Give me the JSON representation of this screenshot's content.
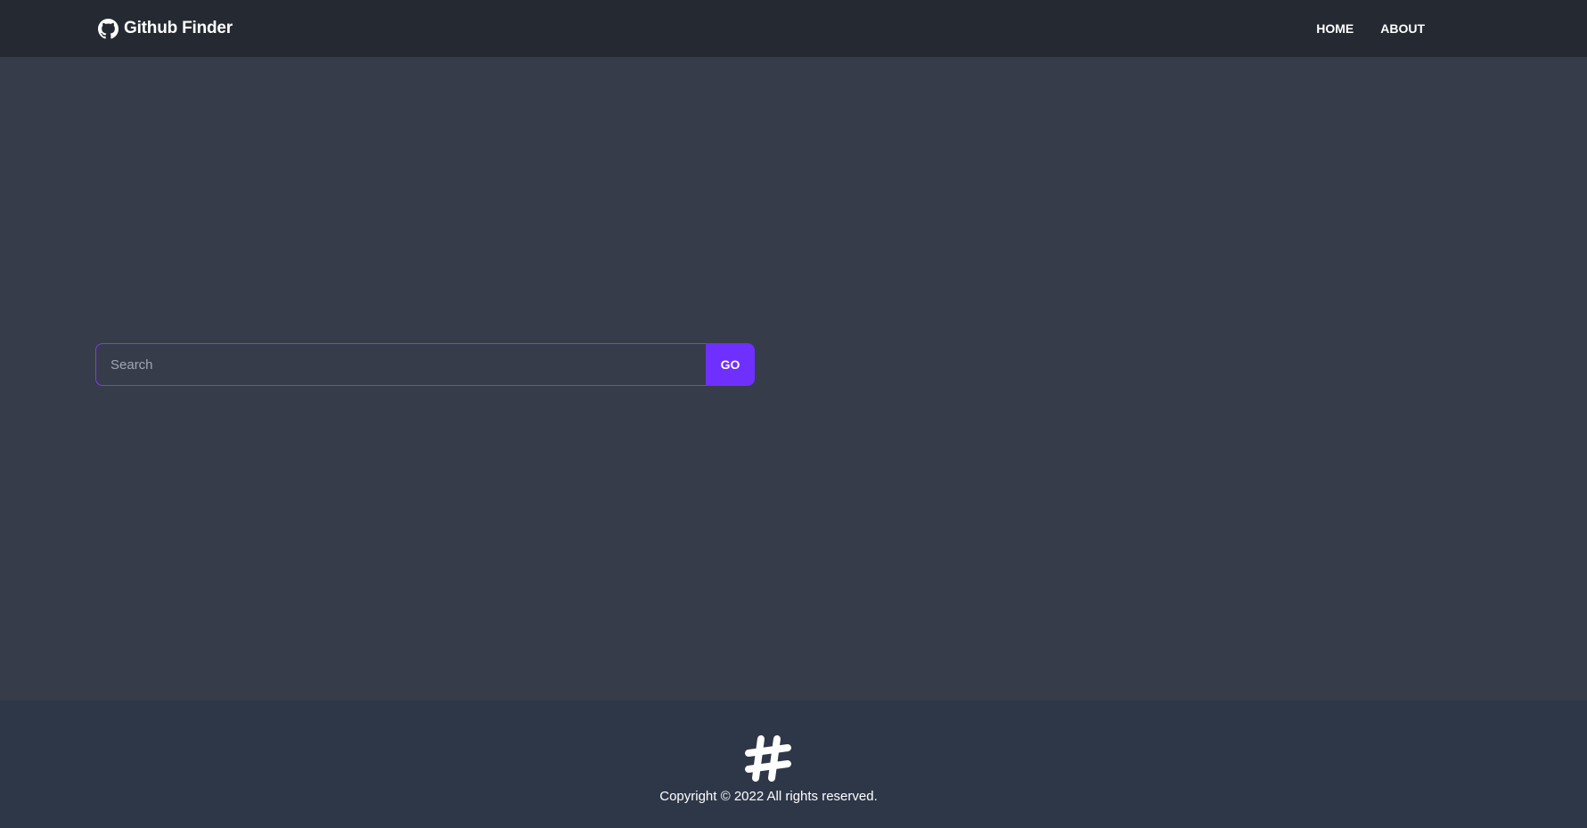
{
  "navbar": {
    "brand_icon": "github-icon",
    "brand_title": "Github Finder",
    "links": [
      {
        "label": "HOME"
      },
      {
        "label": "ABOUT"
      }
    ]
  },
  "search": {
    "placeholder": "Search",
    "value": "",
    "button_label": "GO"
  },
  "footer": {
    "logo_icon": "slack-hash-icon",
    "copyright": "Copyright © 2022 All rights reserved."
  },
  "colors": {
    "navbar_bg": "#242932",
    "page_bg": "#363c4a",
    "footer_bg": "#2e3748",
    "accent": "#6e2fff"
  }
}
